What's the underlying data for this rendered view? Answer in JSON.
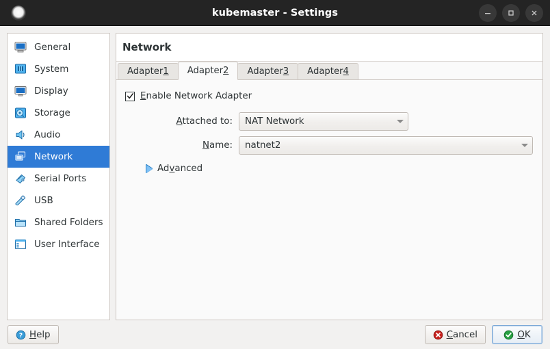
{
  "window": {
    "title": "kubemaster - Settings",
    "app_icon": "vm-circle-icon",
    "controls": {
      "minimize": "minimize-icon",
      "maximize": "maximize-icon",
      "close": "close-icon"
    }
  },
  "sidebar": {
    "items": [
      {
        "label": "General",
        "icon": "monitor-icon",
        "selected": false
      },
      {
        "label": "System",
        "icon": "motherboard-icon",
        "selected": false
      },
      {
        "label": "Display",
        "icon": "display-icon",
        "selected": false
      },
      {
        "label": "Storage",
        "icon": "harddisk-icon",
        "selected": false
      },
      {
        "label": "Audio",
        "icon": "speaker-icon",
        "selected": false
      },
      {
        "label": "Network",
        "icon": "network-icon",
        "selected": true
      },
      {
        "label": "Serial Ports",
        "icon": "serial-port-icon",
        "selected": false
      },
      {
        "label": "USB",
        "icon": "usb-icon",
        "selected": false
      },
      {
        "label": "Shared Folders",
        "icon": "folder-icon",
        "selected": false
      },
      {
        "label": "User Interface",
        "icon": "user-interface-icon",
        "selected": false
      }
    ]
  },
  "panel": {
    "title": "Network",
    "tabs": [
      {
        "pre": "Adapter ",
        "accel": "1",
        "active": false
      },
      {
        "pre": "Adapter ",
        "accel": "2",
        "active": true
      },
      {
        "pre": "Adapter ",
        "accel": "3",
        "active": false
      },
      {
        "pre": "Adapter ",
        "accel": "4",
        "active": false
      }
    ],
    "enable_adapter": {
      "checked": true,
      "accel": "E",
      "label_rest": "nable Network Adapter"
    },
    "attached_to": {
      "label_accel": "A",
      "label_pre": "",
      "label_rest": "ttached to:",
      "value": "NAT Network"
    },
    "name": {
      "label_accel": "N",
      "label_rest": "ame:",
      "value": "natnet2"
    },
    "advanced": {
      "label_pre": "Ad",
      "accel": "v",
      "label_rest": "anced",
      "expanded": false,
      "icon": "disclosure-triangle-icon"
    }
  },
  "footer": {
    "help": {
      "pre": "",
      "accel": "H",
      "rest": "elp",
      "icon": "help-icon"
    },
    "cancel": {
      "pre": "",
      "accel": "C",
      "rest": "ancel",
      "icon": "cancel-icon"
    },
    "ok": {
      "pre": "",
      "accel": "O",
      "rest": "K",
      "icon": "ok-icon",
      "focused": true
    }
  },
  "colors": {
    "accent": "#2f7bd6",
    "titlebar": "#242424",
    "panel_bg": "#fafafa",
    "border": "#cdc7c2",
    "cancel_red": "#c9211e",
    "ok_green": "#26a042",
    "help_blue": "#3b9dd8"
  }
}
